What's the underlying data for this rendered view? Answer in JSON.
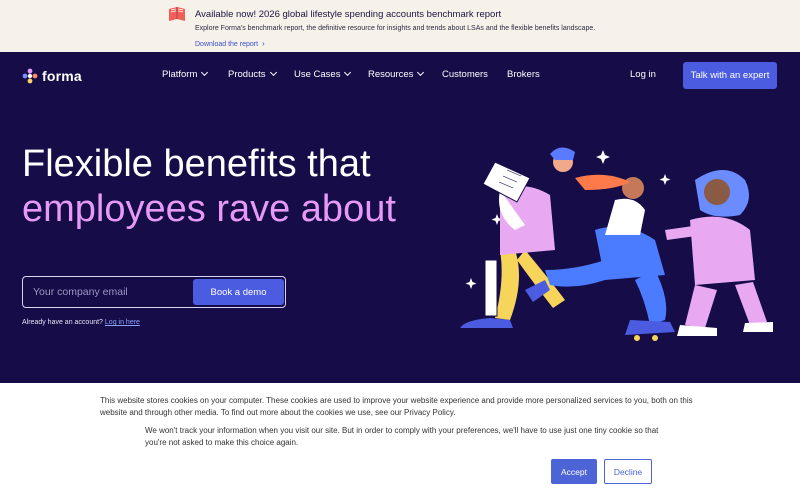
{
  "announcement": {
    "title": "Available now! 2026 global lifestyle spending accounts benchmark report",
    "subtitle": "Explore Forma's benchmark report, the definitive resource for insights and trends about LSAs and the flexible benefits landscape.",
    "link_label": "Download the report",
    "icon": "book-icon"
  },
  "nav": {
    "logo_text": "forma",
    "items": [
      {
        "label": "Platform",
        "has_dropdown": true
      },
      {
        "label": "Products",
        "has_dropdown": true
      },
      {
        "label": "Use Cases",
        "has_dropdown": true
      },
      {
        "label": "Resources",
        "has_dropdown": true
      },
      {
        "label": "Customers",
        "has_dropdown": false
      },
      {
        "label": "Brokers",
        "has_dropdown": false
      }
    ],
    "login_label": "Log in",
    "cta_label": "Talk with an expert"
  },
  "hero": {
    "headline_line1": "Flexible benefits that",
    "headline_line2": "employees rave about",
    "email_placeholder": "Your company email",
    "demo_button": "Book a demo",
    "account_prompt": "Already have an account?",
    "login_link": "Log in here"
  },
  "cookie": {
    "text_1": "This website stores cookies on your computer. These cookies are used to improve your website experience and provide more personalized services to you, both on this website and through other media. To find out more about the cookies we use, see our Privacy Policy.",
    "text_2": "We won't track your information when you visit our site. But in order to comply with your preferences, we'll have to use just one tiny cookie so that you're not asked to make this choice again.",
    "accept_label": "Accept",
    "decline_label": "Decline"
  },
  "colors": {
    "background": "#150c48",
    "accent": "#4b5ce0",
    "headline_highlight": "#e79af5",
    "banner_bg": "#f6f1e9"
  }
}
